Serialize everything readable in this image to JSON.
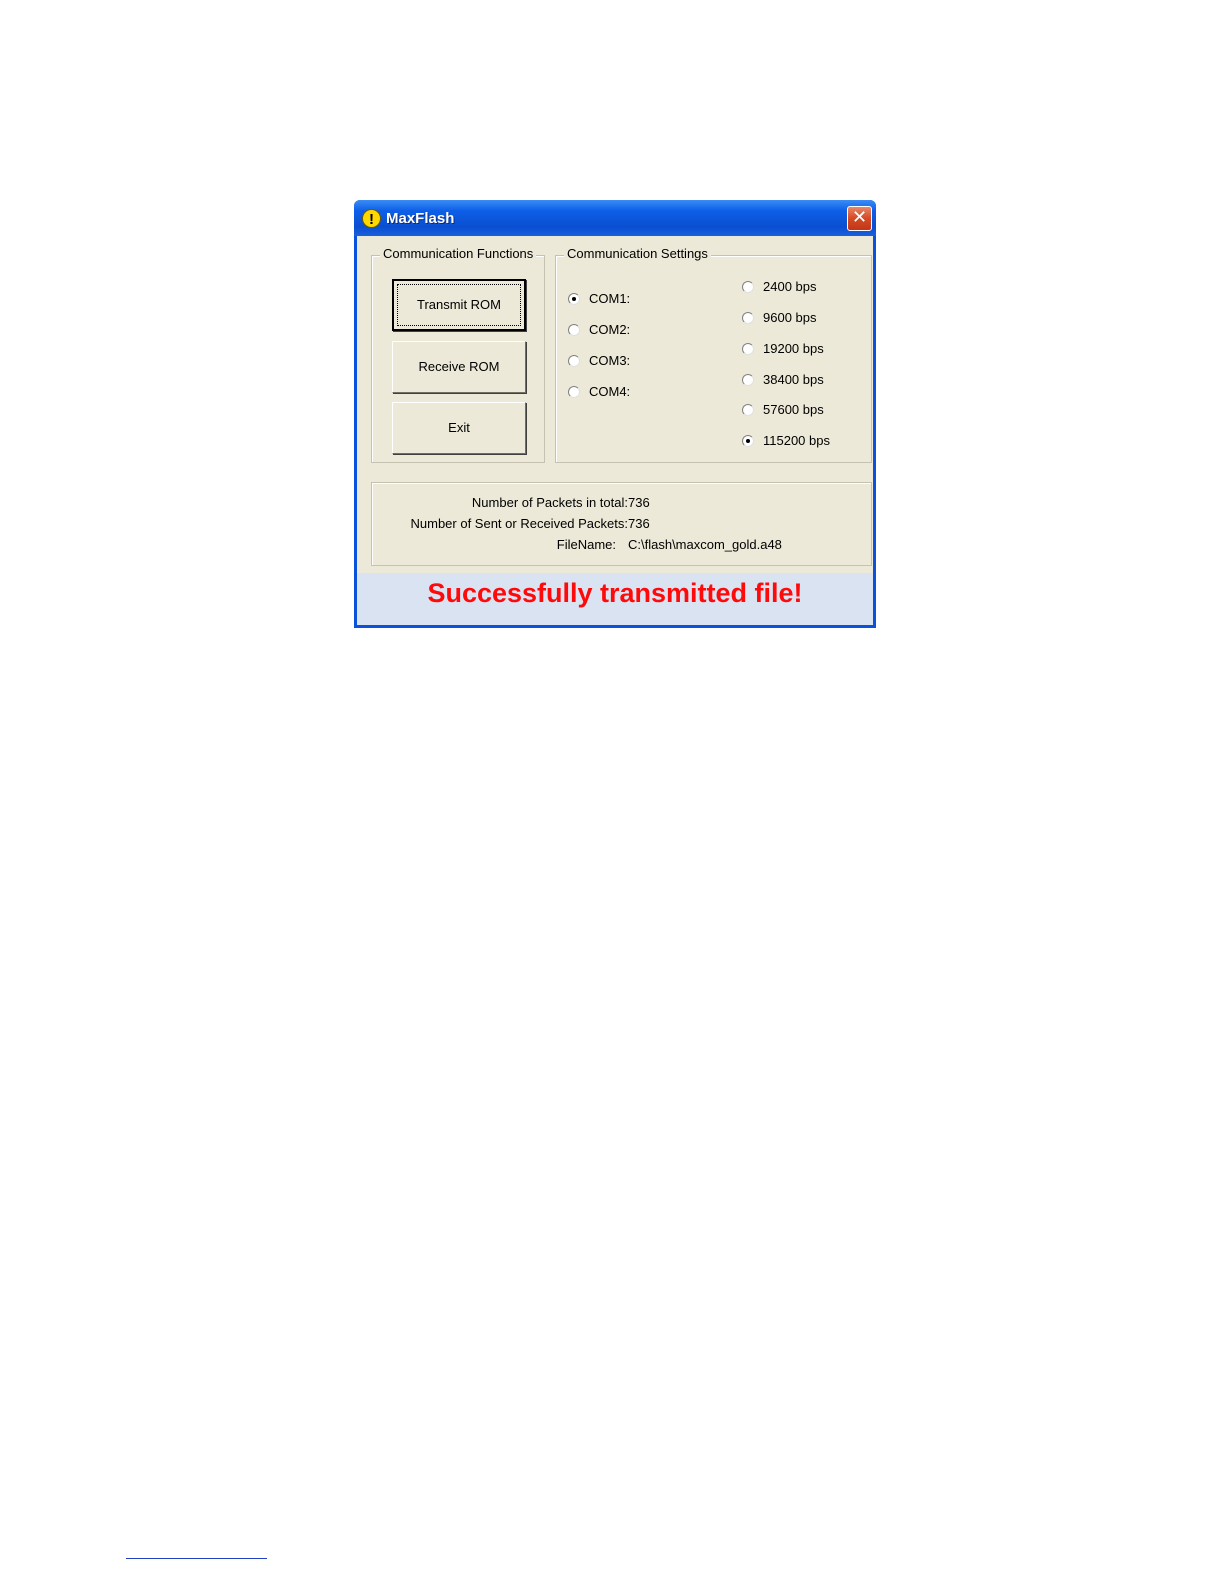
{
  "window": {
    "title": "MaxFlash",
    "title_icon": "exclamation-icon",
    "close_symbol": "✕"
  },
  "functions": {
    "group_label": "Communication Functions",
    "transmit_label": "Transmit ROM",
    "receive_label": "Receive ROM",
    "exit_label": "Exit"
  },
  "settings": {
    "group_label": "Communication Settings",
    "ports": [
      {
        "label": "COM1:",
        "checked": true
      },
      {
        "label": "COM2:",
        "checked": false
      },
      {
        "label": "COM3:",
        "checked": false
      },
      {
        "label": "COM4:",
        "checked": false
      }
    ],
    "speeds": [
      {
        "label": "2400 bps",
        "checked": false
      },
      {
        "label": "9600 bps",
        "checked": false
      },
      {
        "label": "19200 bps",
        "checked": false
      },
      {
        "label": "38400 bps",
        "checked": false
      },
      {
        "label": "57600 bps",
        "checked": false
      },
      {
        "label": "115200 bps",
        "checked": true
      }
    ]
  },
  "info": {
    "total_label": "Number of Packets in total:",
    "total_value": "736",
    "sent_label": "Number of Sent or Received Packets:",
    "sent_value": "736",
    "filename_label": "FileName:",
    "filename_value": "C:\\flash\\maxcom_gold.a48"
  },
  "status": {
    "message": "Successfully transmitted file!",
    "color": "#ff0a0a",
    "background": "#d9e3f2"
  },
  "colors": {
    "titlebar": "#0a52dc",
    "dialog_face": "#ece9d8"
  }
}
